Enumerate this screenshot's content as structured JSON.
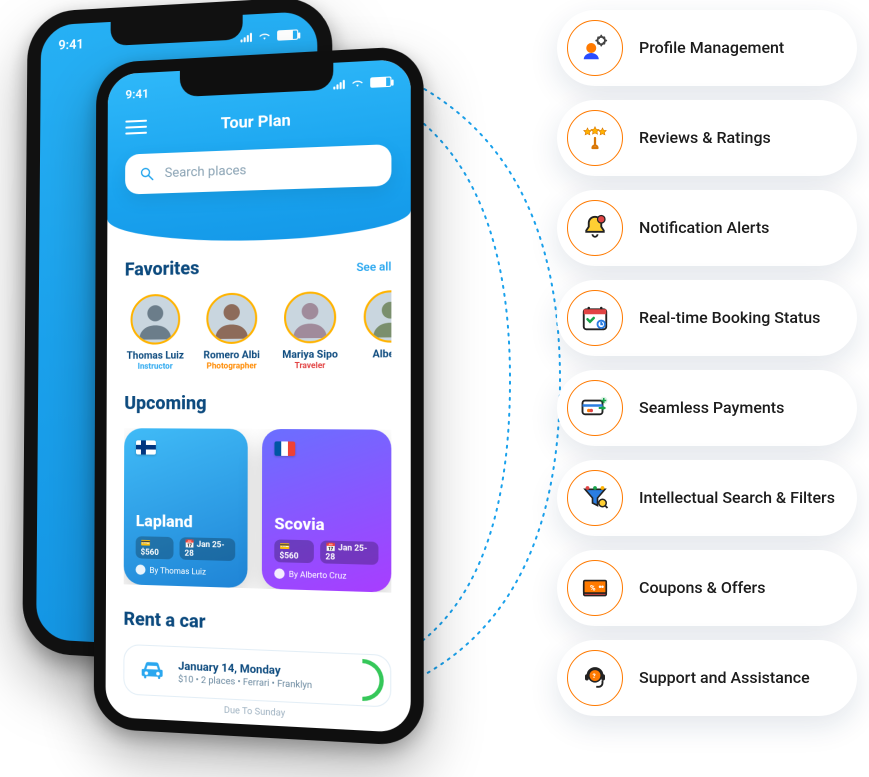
{
  "status_time": "9:41",
  "app": {
    "title": "Tour Plan",
    "search_placeholder": "Search places"
  },
  "sections": {
    "favorites": {
      "title": "Favorites",
      "see_all": "See all"
    },
    "upcoming": {
      "title": "Upcoming"
    },
    "rent": {
      "title": "Rent a car"
    }
  },
  "favorites": [
    {
      "name": "Thomas Luiz",
      "role": "Instructor",
      "role_color": "blue"
    },
    {
      "name": "Romero Albi",
      "role": "Photographer",
      "role_color": "orange"
    },
    {
      "name": "Mariya Sipo",
      "role": "Traveler",
      "role_color": "red"
    },
    {
      "name": "Alberto",
      "role": "",
      "role_color": "blue"
    }
  ],
  "upcoming": [
    {
      "destination": "Lapland",
      "price": "$560",
      "dates": "Jan 25-28",
      "by": "By Thomas Luiz",
      "flag": "fi"
    },
    {
      "destination": "Scovia",
      "price": "$560",
      "dates": "Jan 25-28",
      "by": "By Alberto Cruz",
      "flag": "fr"
    }
  ],
  "rent": {
    "date": "January 14, Monday",
    "sub": "$10  •  2 places  •  Ferrari  •  Franklyn",
    "note": "Due To Sunday"
  },
  "features": [
    "Profile Management",
    "Reviews & Ratings",
    "Notification Alerts",
    "Real-time Booking Status",
    "Seamless Payments",
    "Intellectual Search & Filters",
    "Coupons & Offers",
    "Support and Assistance"
  ]
}
